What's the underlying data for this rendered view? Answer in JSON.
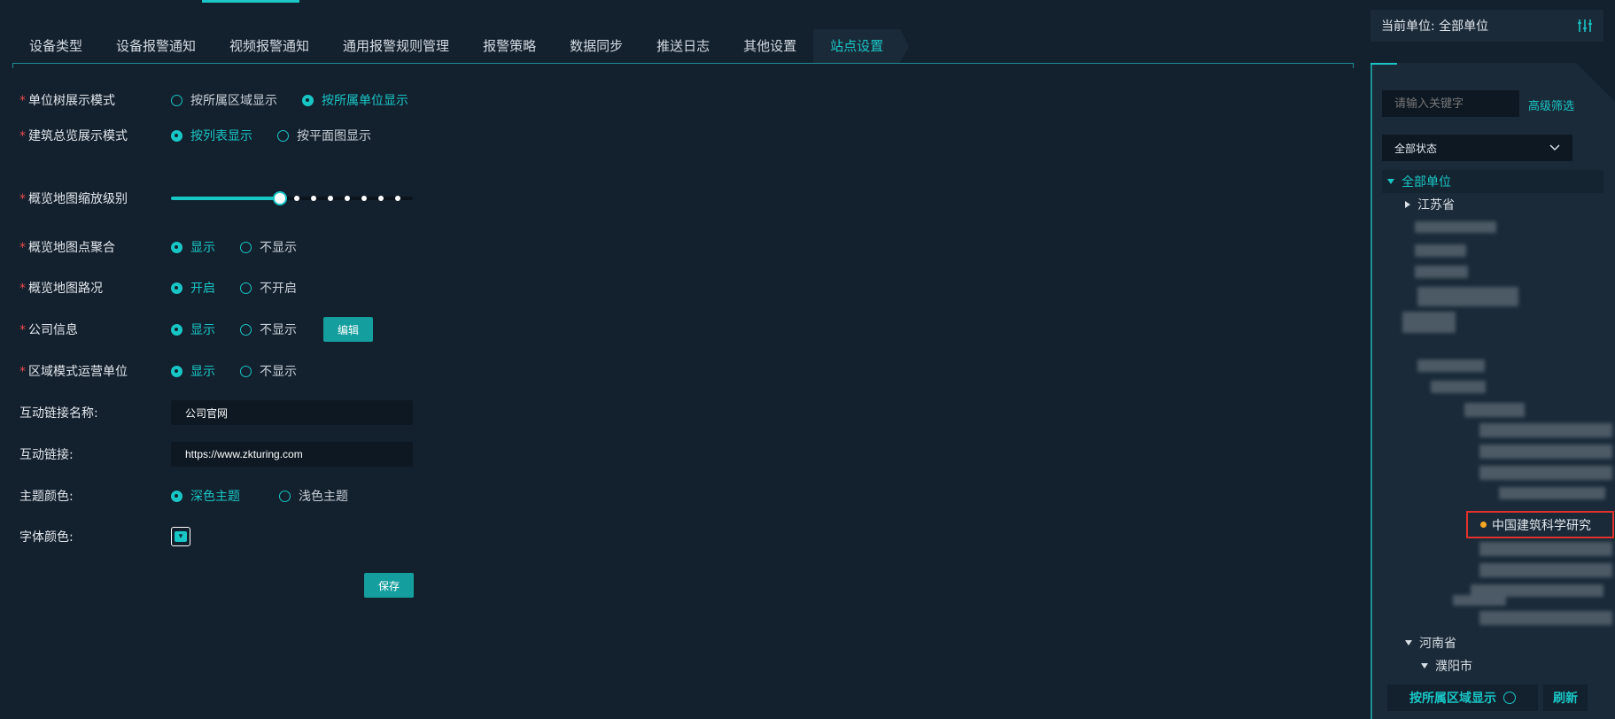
{
  "tabs": [
    {
      "label": "设备类型"
    },
    {
      "label": "设备报警通知"
    },
    {
      "label": "视频报警通知"
    },
    {
      "label": "通用报警规则管理"
    },
    {
      "label": "报警策略"
    },
    {
      "label": "数据同步"
    },
    {
      "label": "推送日志"
    },
    {
      "label": "其他设置"
    },
    {
      "label": "站点设置",
      "active": true
    }
  ],
  "form": {
    "tree_mode": {
      "label": "单位树展示模式",
      "options": [
        "按所属区域显示",
        "按所属单位显示"
      ],
      "selected": "按所属单位显示"
    },
    "building_mode": {
      "label": "建筑总览展示模式",
      "options": [
        "按列表显示",
        "按平面图显示"
      ],
      "selected": "按列表显示"
    },
    "zoom_level": {
      "label": "概览地图缩放级别",
      "level": 0.45
    },
    "cluster": {
      "label": "概览地图点聚合",
      "options": [
        "显示",
        "不显示"
      ],
      "selected": "显示"
    },
    "traffic": {
      "label": "概览地图路况",
      "options": [
        "开启",
        "不开启"
      ],
      "selected": "开启"
    },
    "company_info": {
      "label": "公司信息",
      "options": [
        "显示",
        "不显示"
      ],
      "selected": "显示",
      "edit_label": "编辑"
    },
    "region_operator": {
      "label": "区域模式运营单位",
      "options": [
        "显示",
        "不显示"
      ],
      "selected": "显示"
    },
    "link_name": {
      "label": "互动链接名称:",
      "value": "公司官网"
    },
    "link_url": {
      "label": "互动链接:",
      "value": "https://www.zkturing.com"
    },
    "theme": {
      "label": "主题颜色:",
      "options": [
        "深色主题",
        "浅色主题"
      ],
      "selected": "深色主题"
    },
    "font_color": {
      "label": "字体颜色:",
      "color": "#19c6c6"
    },
    "save_label": "保存",
    "required_mark": "*"
  },
  "right_panel": {
    "current_unit": "当前单位: 全部单位",
    "search_placeholder": "请输入关键字",
    "advanced_filter": "高级筛选",
    "status_select": "全部状态",
    "tree": {
      "root": "全部单位",
      "province_1": "江苏省",
      "highlighted_unit": "中国建筑科学研究",
      "province_2": "河南省",
      "city_2": "濮阳市"
    },
    "bottom_mode": "按所属区域显示",
    "refresh": "刷新"
  },
  "colors": {
    "accent": "#19c6c6",
    "background": "#13202d",
    "panel": "#1a2a38",
    "required": "#e84a4a",
    "highlight_border": "#e0322a",
    "status_dot": "#f5a623"
  }
}
